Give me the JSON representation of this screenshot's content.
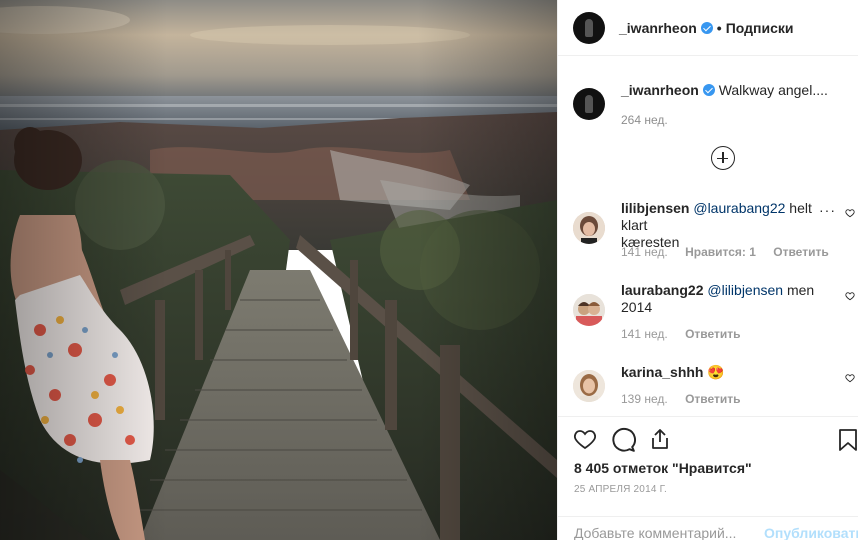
{
  "post": {
    "username": "_iwanrheon",
    "follow_label": "Подписки",
    "caption": "Walkway angel....",
    "caption_time": "264 нед.",
    "likes": "8 405 отметок \"Нравится\"",
    "date": "25 АПРЕЛЯ 2014 Г."
  },
  "comments": [
    {
      "username": "lilibjensen",
      "mention": "@laurabang22",
      "text_line1": " helt klart",
      "text_line2": "kæresten",
      "time": "141 нед.",
      "likes_label": "Нравится: 1",
      "reply_label": "Ответить"
    },
    {
      "username": "laurabang22",
      "mention": "@lilibjensen",
      "text_line1": " men",
      "text_line2": "2014",
      "time": "141 нед.",
      "reply_label": "Ответить"
    },
    {
      "username": "karina_shhh",
      "emoji": "😍",
      "time": "139 нед.",
      "reply_label": "Ответить"
    }
  ],
  "comment_box": {
    "placeholder": "Добавьте комментарий...",
    "publish_label": "Опубликовать"
  },
  "icons": [
    "verified-icon",
    "load-more-icon",
    "like-icon",
    "comment-icon",
    "share-icon",
    "bookmark-icon",
    "small-heart-icon"
  ],
  "colors": {
    "accent": "#3897f0",
    "publish_disabled": "#b2dffc",
    "meta": "#999999"
  }
}
